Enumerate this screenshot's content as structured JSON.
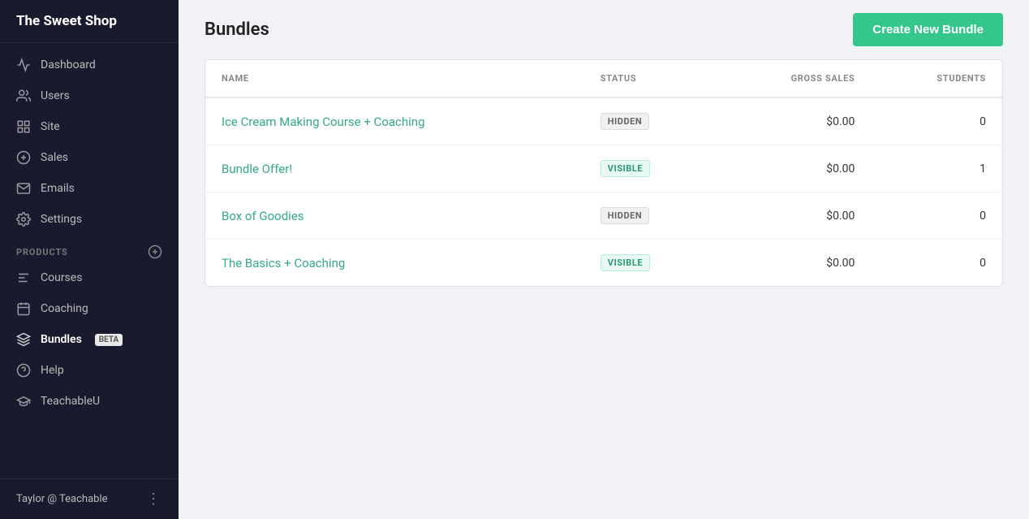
{
  "app": {
    "name": "The Sweet Shop"
  },
  "sidebar": {
    "nav_items": [
      {
        "id": "dashboard",
        "label": "Dashboard",
        "icon": "dashboard"
      },
      {
        "id": "users",
        "label": "Users",
        "icon": "users"
      },
      {
        "id": "site",
        "label": "Site",
        "icon": "site"
      },
      {
        "id": "sales",
        "label": "Sales",
        "icon": "sales"
      },
      {
        "id": "emails",
        "label": "Emails",
        "icon": "emails"
      },
      {
        "id": "settings",
        "label": "Settings",
        "icon": "settings"
      }
    ],
    "products_label": "PRODUCTS",
    "products_items": [
      {
        "id": "courses",
        "label": "Courses",
        "icon": "courses"
      },
      {
        "id": "coaching",
        "label": "Coaching",
        "icon": "coaching"
      },
      {
        "id": "bundles",
        "label": "Bundles",
        "icon": "bundles",
        "badge": "BETA",
        "active": true
      }
    ],
    "bottom_items": [
      {
        "id": "help",
        "label": "Help",
        "icon": "help"
      },
      {
        "id": "teachableu",
        "label": "TeachableU",
        "icon": "teachableu"
      }
    ],
    "footer": {
      "user": "Taylor @ Teachable",
      "dots": "⋮"
    }
  },
  "main": {
    "page_title": "Bundles",
    "create_button_label": "Create New Bundle",
    "table": {
      "columns": [
        "NAME",
        "STATUS",
        "GROSS SALES",
        "STUDENTS"
      ],
      "rows": [
        {
          "name": "Ice Cream Making Course + Coaching",
          "status": "HIDDEN",
          "gross_sales": "$0.00",
          "students": "0"
        },
        {
          "name": "Bundle Offer!",
          "status": "VISIBLE",
          "gross_sales": "$0.00",
          "students": "1"
        },
        {
          "name": "Box of Goodies",
          "status": "HIDDEN",
          "gross_sales": "$0.00",
          "students": "0"
        },
        {
          "name": "The Basics + Coaching",
          "status": "VISIBLE",
          "gross_sales": "$0.00",
          "students": "0"
        }
      ]
    }
  },
  "colors": {
    "accent": "#34c68a",
    "sidebar_bg": "#1a1a2e",
    "hidden_badge_bg": "#f0f0f0",
    "visible_badge_bg": "#e8f8f2"
  }
}
